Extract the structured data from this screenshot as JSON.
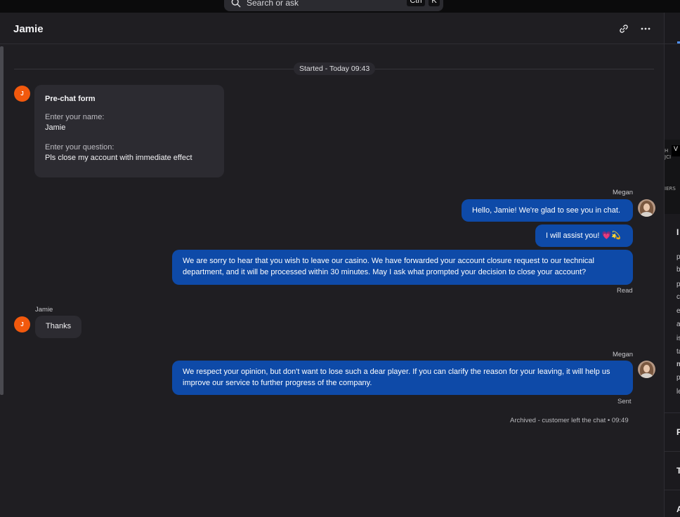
{
  "search": {
    "placeholder": "Search or ask",
    "key1": "Ctrl",
    "key2": "K"
  },
  "header": {
    "title": "Jamie"
  },
  "chat": {
    "started": "Started - Today 09:43",
    "customer_initial": "J",
    "prechat": {
      "title": "Pre-chat form",
      "name_label": "Enter your name:",
      "name_value": "Jamie",
      "question_label": "Enter your question:",
      "question_value": "Pls close my account with immediate effect"
    },
    "agent_name": "Megan",
    "customer_name": "Jamie",
    "messages": [
      {
        "text": "Hello, Jamie! We're glad to see you in chat."
      },
      {
        "text": "I will assist you! 💗💫"
      },
      {
        "text": "We are sorry to hear that you wish to leave our casino. We have forwarded your account closure request to our technical department, and it will be processed within 30 minutes. May I ask what prompted your decision to close your account?"
      },
      {
        "text": "Thanks"
      },
      {
        "text": "We respect your opinion, but don't want to lose such a dear player. If you can clarify the reason for your leaving, it will help us improve our service to further progress of the company."
      }
    ],
    "status_read": "Read",
    "status_sent": "Sent",
    "archived": "Archived - customer left the chat • 09:49"
  },
  "sidebar": {
    "map_text_1": "H",
    "map_text_2": "JCI",
    "map_text_3": "IERS",
    "map_button": "V",
    "section_heading": "I",
    "letters": [
      "p",
      "b",
      "p",
      "c",
      "e",
      "a",
      "is",
      "ta",
      "m",
      "p",
      "le"
    ],
    "heading_2": "F",
    "heading_3": "T",
    "heading_4": "A"
  }
}
